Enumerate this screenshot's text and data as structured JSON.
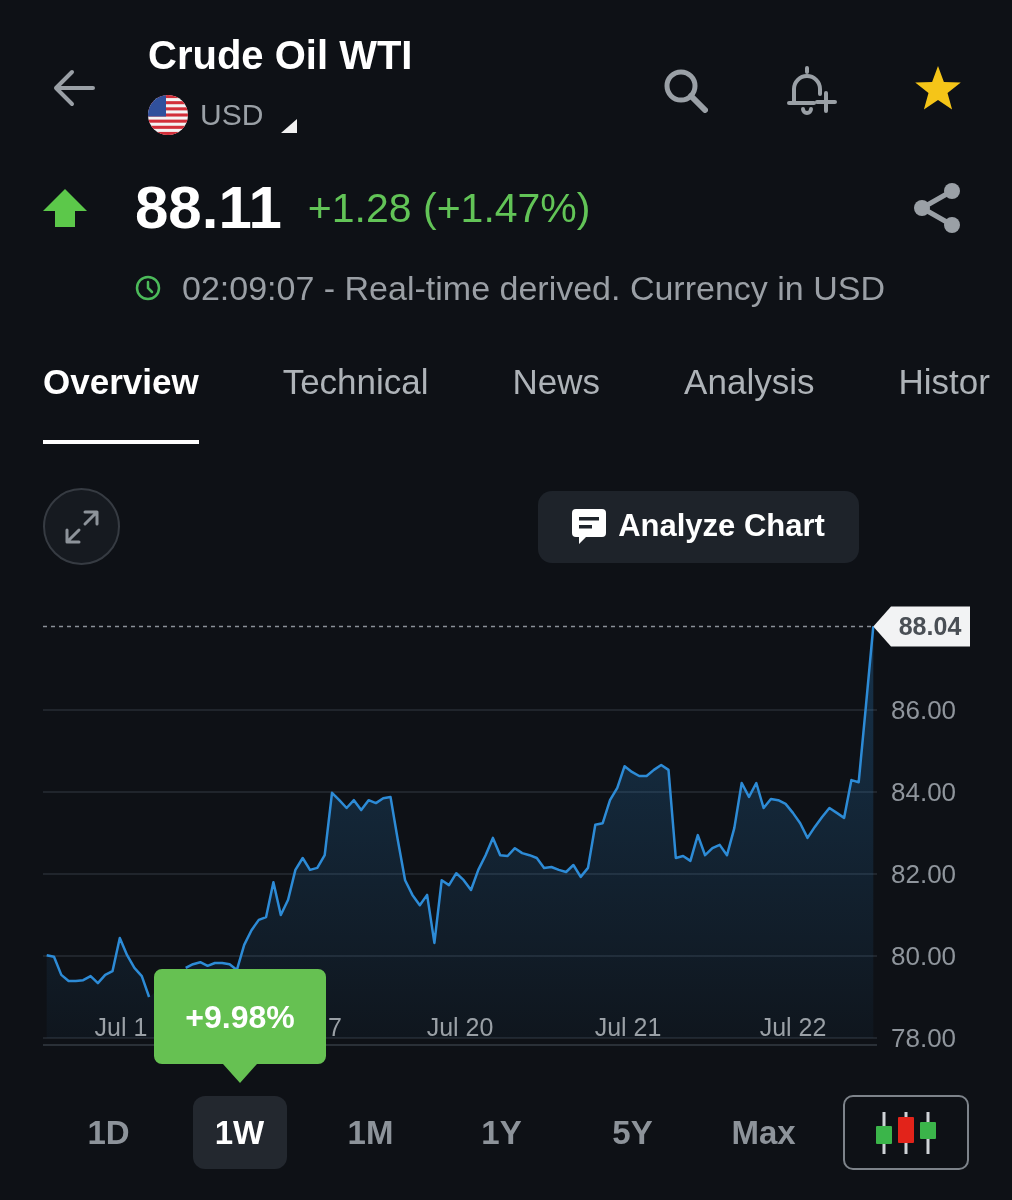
{
  "header": {
    "title": "Crude Oil WTI",
    "currency": "USD",
    "favorite": true
  },
  "quote": {
    "rising": true,
    "price": "88.11",
    "change": "+1.28 (+1.47%)",
    "timestamp": "02:09:07 - Real-time derived. Currency in USD"
  },
  "tabs": [
    {
      "label": "Overview",
      "selected": true
    },
    {
      "label": "Technical",
      "selected": false
    },
    {
      "label": "News",
      "selected": false
    },
    {
      "label": "Analysis",
      "selected": false
    },
    {
      "label": "Histor",
      "selected": false
    }
  ],
  "chart_tools": {
    "analyze_button": "Analyze Chart"
  },
  "chart": {
    "chart_data": {
      "type": "area",
      "grid": true,
      "series": [
        {
          "color": "#2d8bd6",
          "values": [
            80.02,
            79.98,
            79.54,
            79.39,
            79.39,
            79.41,
            79.51,
            79.34,
            79.54,
            79.63,
            80.44,
            80.02,
            79.71,
            79.51,
            79.0,
            null,
            null,
            null,
            null,
            79.71,
            79.8,
            79.85,
            79.76,
            79.83,
            79.83,
            79.8,
            79.66,
            80.27,
            80.63,
            80.88,
            80.95,
            81.8,
            81.0,
            81.37,
            82.1,
            82.39,
            82.1,
            82.15,
            82.46,
            83.98,
            83.8,
            83.61,
            83.8,
            83.56,
            83.8,
            83.73,
            83.85,
            83.88,
            82.83,
            81.85,
            81.49,
            81.24,
            81.49,
            80.32,
            81.85,
            81.73,
            82.02,
            81.85,
            81.61,
            82.1,
            82.46,
            82.88,
            82.46,
            82.44,
            82.63,
            82.51,
            82.46,
            82.39,
            82.15,
            82.17,
            82.1,
            82.05,
            82.22,
            81.93,
            82.15,
            83.2,
            83.24,
            83.8,
            84.1,
            84.63,
            84.49,
            84.39,
            84.39,
            84.54,
            84.66,
            84.54,
            82.39,
            82.44,
            82.32,
            82.95,
            82.46,
            82.63,
            82.71,
            82.46,
            83.12,
            84.22,
            83.88,
            84.22,
            83.61,
            83.83,
            83.8,
            83.71,
            83.49,
            83.24,
            82.88,
            83.15,
            83.39,
            83.61,
            83.49,
            83.37,
            84.29,
            84.24,
            86.12,
            88.04
          ]
        }
      ],
      "ylim": [
        78,
        88.04
      ],
      "yticks": [
        {
          "value": 78,
          "label": "78.00"
        },
        {
          "value": 80,
          "label": "80.00"
        },
        {
          "value": 82,
          "label": "82.00"
        },
        {
          "value": 84,
          "label": "84.00"
        },
        {
          "value": 86,
          "label": "86.00"
        }
      ],
      "ref_lines": [
        {
          "axis": "y",
          "value": 88.04,
          "label": "88.04"
        }
      ]
    },
    "date_labels": [
      "Jul 1",
      "7",
      "Jul 20",
      "Jul 21",
      "Jul 22"
    ]
  },
  "ranges": {
    "items": [
      {
        "label": "1D",
        "selected": false
      },
      {
        "label": "1W",
        "selected": true
      },
      {
        "label": "1M",
        "selected": false
      },
      {
        "label": "1Y",
        "selected": false
      },
      {
        "label": "5Y",
        "selected": false
      },
      {
        "label": "Max",
        "selected": false
      }
    ],
    "change_badge": "+9.98%"
  }
}
